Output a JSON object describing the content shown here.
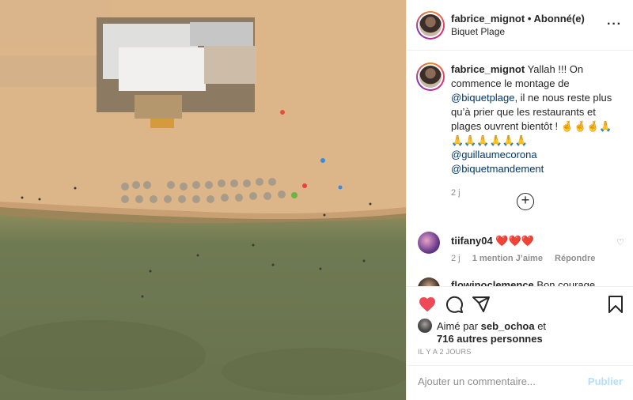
{
  "post": {
    "username": "fabrice_mignot",
    "separator": "•",
    "follow_status": "Abonné(e)",
    "location": "Biquet Plage",
    "more_icon": "more-icon"
  },
  "caption": {
    "username": "fabrice_mignot",
    "text_1": "Yallah !!! On commence le montage de",
    "mention_1": "@biquetplage",
    "text_2": ", il ne nous reste plus qu’à prier que les restaurants et plages ouvrent bientôt ! 🤞🤞🤞🙏 🙏🙏🙏🙏🙏🙏",
    "mention_2": "@guillaumecorona",
    "mention_3": "@biquetmandement",
    "time": "2 j"
  },
  "load_more_icon": "plus-circle-icon",
  "comments": [
    {
      "username": "tiifany04",
      "text": "❤️❤️❤️",
      "time": "2 j",
      "likes": "1 mention J’aime",
      "reply": "Répondre"
    },
    {
      "username": "flowinoclemence",
      "text": "Bon courage"
    }
  ],
  "likes": {
    "prefix": "Aimé par",
    "user": "seb_ochoa",
    "suffix": "et",
    "others": "716 autres personnes"
  },
  "timestamp": "IL Y A 2 JOURS",
  "add_comment": {
    "placeholder": "Ajouter un commentaire...",
    "publish": "Publier"
  },
  "colors": {
    "heart": "#ed4956",
    "link": "#00376b",
    "publish_disabled": "#b2dffc"
  }
}
